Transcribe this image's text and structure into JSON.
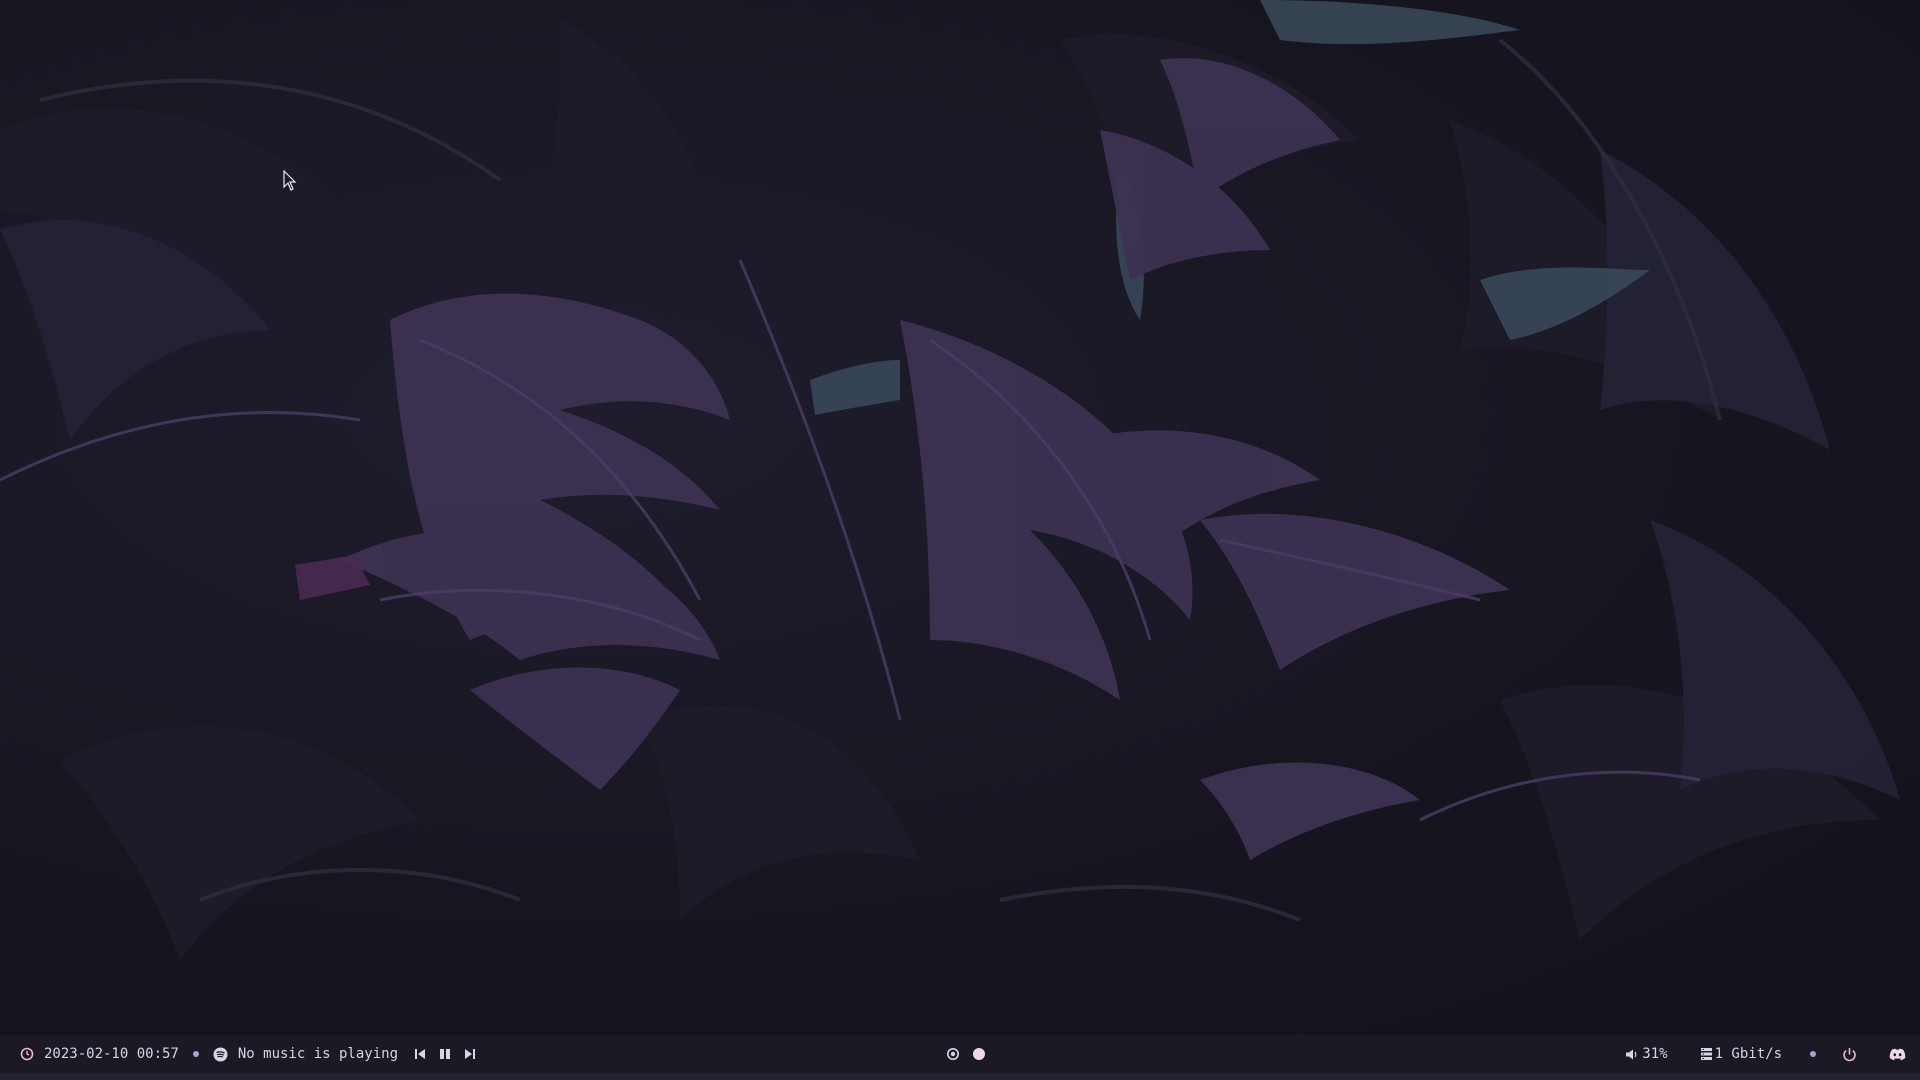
{
  "colors": {
    "bar_bg": "#1a1924",
    "accent": "#b99ad8",
    "text": "#d8d4e6",
    "icon_pink": "#f0b4d6"
  },
  "statusbar": {
    "datetime": "2023-02-10 00:57",
    "music_status": "No music is playing",
    "volume": "31%",
    "network": "1 Gbit/s"
  },
  "icons": {
    "clock": "clock-icon",
    "spotify": "spotify-icon",
    "prev": "skip-previous-icon",
    "pause": "pause-icon",
    "next": "skip-next-icon",
    "workspace_ring": "workspace-ring-icon",
    "workspace_active": "workspace-active-dot-icon",
    "volume": "speaker-icon",
    "network": "ethernet-icon",
    "power": "power-icon",
    "discord": "discord-icon"
  }
}
